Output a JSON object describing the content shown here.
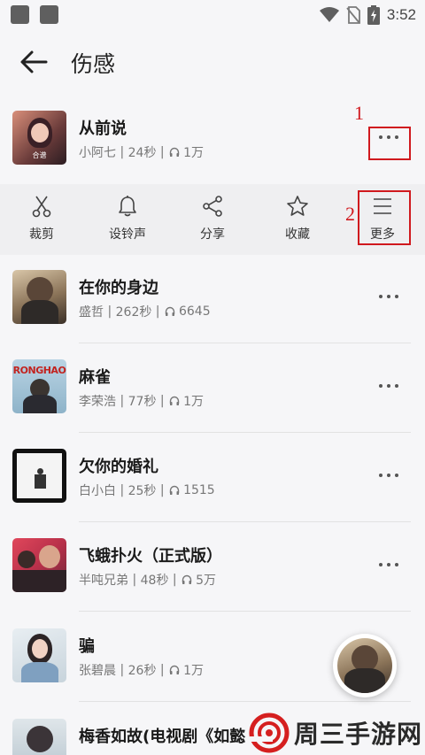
{
  "status_bar": {
    "time": "3:52"
  },
  "app_bar": {
    "title": "伤感",
    "back_icon": "arrow-left-icon"
  },
  "songs": [
    {
      "title": "从前说",
      "artist": "小阿七",
      "duration": "24秒",
      "plays": "1万",
      "cover_text": "合谱"
    },
    {
      "title": "在你的身边",
      "artist": "盛哲",
      "duration": "262秒",
      "plays": "6645"
    },
    {
      "title": "麻雀",
      "artist": "李荣浩",
      "duration": "77秒",
      "plays": "1万",
      "cover_text": "RONGHAO"
    },
    {
      "title": "欠你的婚礼",
      "artist": "白小白",
      "duration": " 25秒",
      "plays": "1515"
    },
    {
      "title": "飞蛾扑火（正式版）",
      "artist": "半吨兄弟",
      "duration": "48秒",
      "plays": "5万"
    },
    {
      "title": "骗",
      "artist": "张碧晨",
      "duration": "26秒",
      "plays": "1万"
    },
    {
      "title": "梅香如故(电视剧《如懿",
      "artist": "",
      "duration": "",
      "plays": ""
    }
  ],
  "actions": [
    {
      "label": "裁剪",
      "icon": "scissors-icon"
    },
    {
      "label": "设铃声",
      "icon": "bell-icon"
    },
    {
      "label": "分享",
      "icon": "share-icon"
    },
    {
      "label": "收藏",
      "icon": "star-icon"
    },
    {
      "label": "更多",
      "icon": "menu-icon"
    }
  ],
  "annotations": {
    "marker_1": "1",
    "marker_2": "2"
  },
  "watermark": {
    "text": "周三手游网"
  },
  "colors": {
    "annotation_red": "#d0191e",
    "background": "#f6f6f8",
    "action_bar": "#efeff1"
  }
}
